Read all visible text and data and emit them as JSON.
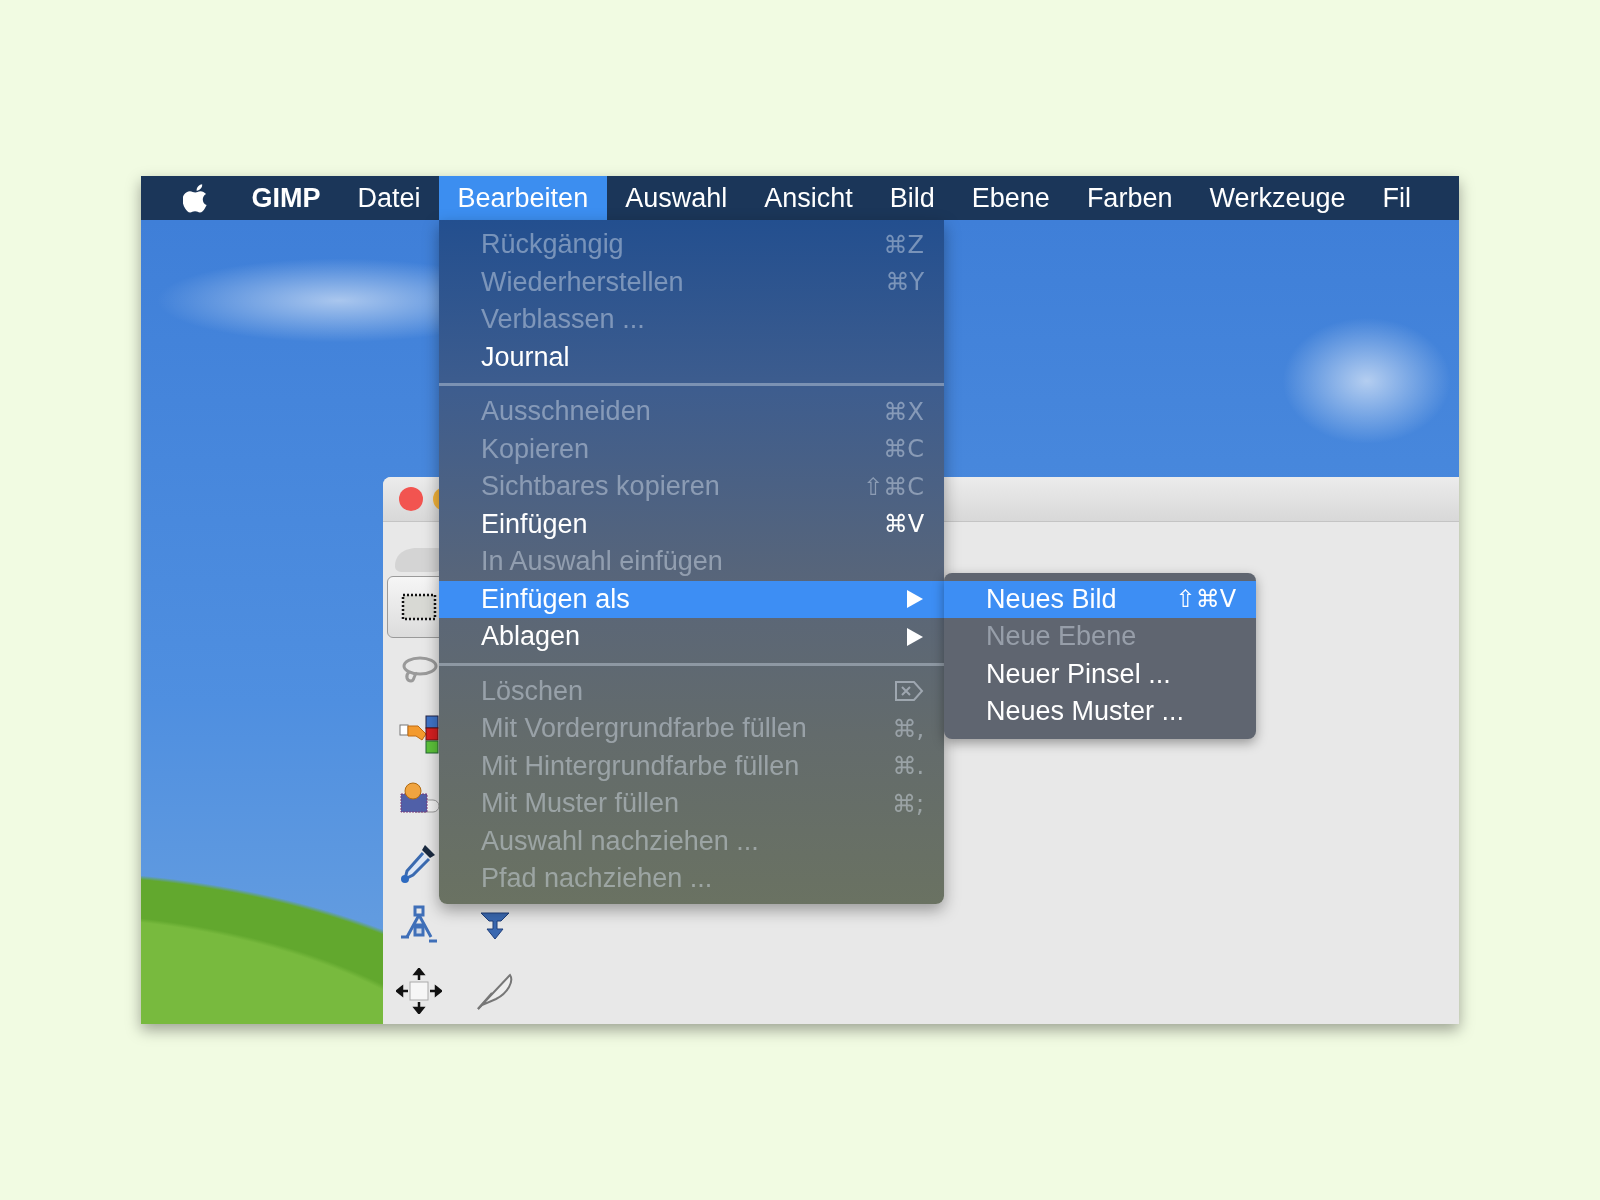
{
  "menubar": {
    "items": [
      {
        "label": "GIMP",
        "kind": "app",
        "selected": false
      },
      {
        "label": "Datei",
        "kind": "menu",
        "selected": false
      },
      {
        "label": "Bearbeiten",
        "kind": "menu",
        "selected": true
      },
      {
        "label": "Auswahl",
        "kind": "menu",
        "selected": false
      },
      {
        "label": "Ansicht",
        "kind": "menu",
        "selected": false
      },
      {
        "label": "Bild",
        "kind": "menu",
        "selected": false
      },
      {
        "label": "Ebene",
        "kind": "menu",
        "selected": false
      },
      {
        "label": "Farben",
        "kind": "menu",
        "selected": false
      },
      {
        "label": "Werkzeuge",
        "kind": "menu",
        "selected": false
      },
      {
        "label": "Fil",
        "kind": "menu",
        "selected": false
      }
    ]
  },
  "menu": {
    "sections": [
      [
        {
          "label": "Rückgängig",
          "shortcut": "⌘Z",
          "disabled": true,
          "selected": false
        },
        {
          "label": "Wiederherstellen",
          "shortcut": "⌘Y",
          "disabled": true,
          "selected": false
        },
        {
          "label": "Verblassen ...",
          "disabled": true,
          "selected": false
        },
        {
          "label": "Journal",
          "disabled": false,
          "selected": false
        }
      ],
      [
        {
          "label": "Ausschneiden",
          "shortcut": "⌘X",
          "disabled": true,
          "selected": false
        },
        {
          "label": "Kopieren",
          "shortcut": "⌘C",
          "disabled": true,
          "selected": false
        },
        {
          "label": "Sichtbares kopieren",
          "shortcut": "⇧⌘C",
          "disabled": true,
          "selected": false
        },
        {
          "label": "Einfügen",
          "shortcut": "⌘V",
          "disabled": false,
          "selected": false
        },
        {
          "label": "In Auswahl einfügen",
          "disabled": true,
          "selected": false
        },
        {
          "label": "Einfügen als",
          "disabled": false,
          "selected": true,
          "has_submenu": true,
          "children": [
            {
              "label": "Neues Bild",
              "shortcut": "⇧⌘V",
              "disabled": false,
              "selected": true
            },
            {
              "label": "Neue Ebene",
              "disabled": true,
              "selected": false
            },
            {
              "label": "Neuer Pinsel ...",
              "disabled": false,
              "selected": false
            },
            {
              "label": "Neues Muster ...",
              "disabled": false,
              "selected": false
            }
          ]
        },
        {
          "label": "Ablagen",
          "disabled": false,
          "selected": false,
          "has_submenu": true
        }
      ],
      [
        {
          "label": "Löschen",
          "delete_key": true,
          "disabled": true,
          "selected": false
        },
        {
          "label": "Mit Vordergrundfarbe füllen",
          "shortcut": "⌘,",
          "disabled": true,
          "selected": false
        },
        {
          "label": "Mit Hintergrundfarbe füllen",
          "shortcut": "⌘.",
          "disabled": true,
          "selected": false
        },
        {
          "label": "Mit Muster füllen",
          "shortcut": "⌘;",
          "disabled": true,
          "selected": false
        },
        {
          "label": "Auswahl nachziehen ...",
          "disabled": true,
          "selected": false
        },
        {
          "label": "Pfad nachziehen ...",
          "disabled": true,
          "selected": false
        }
      ]
    ]
  },
  "toolbox": {
    "rows": [
      [
        {
          "kind": "rect-select",
          "selected": true
        }
      ],
      [
        {
          "kind": "lasso",
          "selected": false
        }
      ],
      [
        {
          "kind": "color-select",
          "selected": false
        }
      ],
      [
        {
          "kind": "foreground-select",
          "selected": false
        }
      ],
      [
        {
          "kind": "eyedropper",
          "selected": false
        }
      ],
      [
        {
          "kind": "path",
          "selected": false
        },
        {
          "kind": "warp",
          "selected": false
        }
      ],
      [
        {
          "kind": "move",
          "selected": false
        },
        {
          "kind": "smudge",
          "selected": false
        }
      ]
    ]
  }
}
